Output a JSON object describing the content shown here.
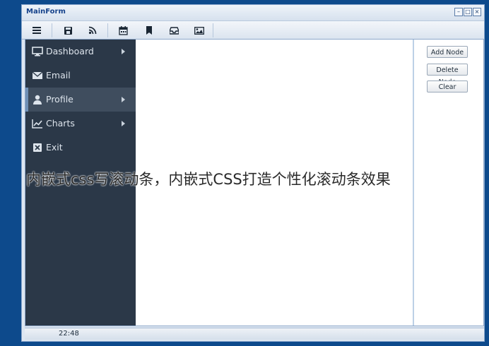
{
  "window": {
    "title": "MainForm",
    "buttons": {
      "minimize": "–",
      "maximize": "□",
      "close": "×"
    }
  },
  "toolbar": {
    "icons": [
      "menu-icon",
      "save-icon",
      "rss-icon",
      "calendar-icon",
      "bookmark-icon",
      "inbox-icon",
      "image-icon"
    ]
  },
  "sidebar": {
    "items": [
      {
        "label": "Dashboard",
        "icon": "monitor-icon",
        "has_arrow": true
      },
      {
        "label": "Email",
        "icon": "envelope-icon",
        "has_arrow": false
      },
      {
        "label": "Profile",
        "icon": "user-icon",
        "has_arrow": true,
        "active": true
      },
      {
        "label": "Charts",
        "icon": "line-chart-icon",
        "has_arrow": true
      },
      {
        "label": "Exit",
        "icon": "close-box-icon",
        "has_arrow": false
      }
    ]
  },
  "actions": {
    "add_node": "Add Node",
    "delete_node": "Delete Node",
    "clear": "Clear"
  },
  "status": {
    "time": "22:48"
  },
  "overlay": {
    "text": "内嵌式css写滚动条，内嵌式CSS打造个性化滚动条效果"
  },
  "colors": {
    "desktop": "#0d4a8c",
    "sidebar": "#2b3848",
    "sidebar_active": "#3f4d5e",
    "title_text": "#15428b"
  }
}
